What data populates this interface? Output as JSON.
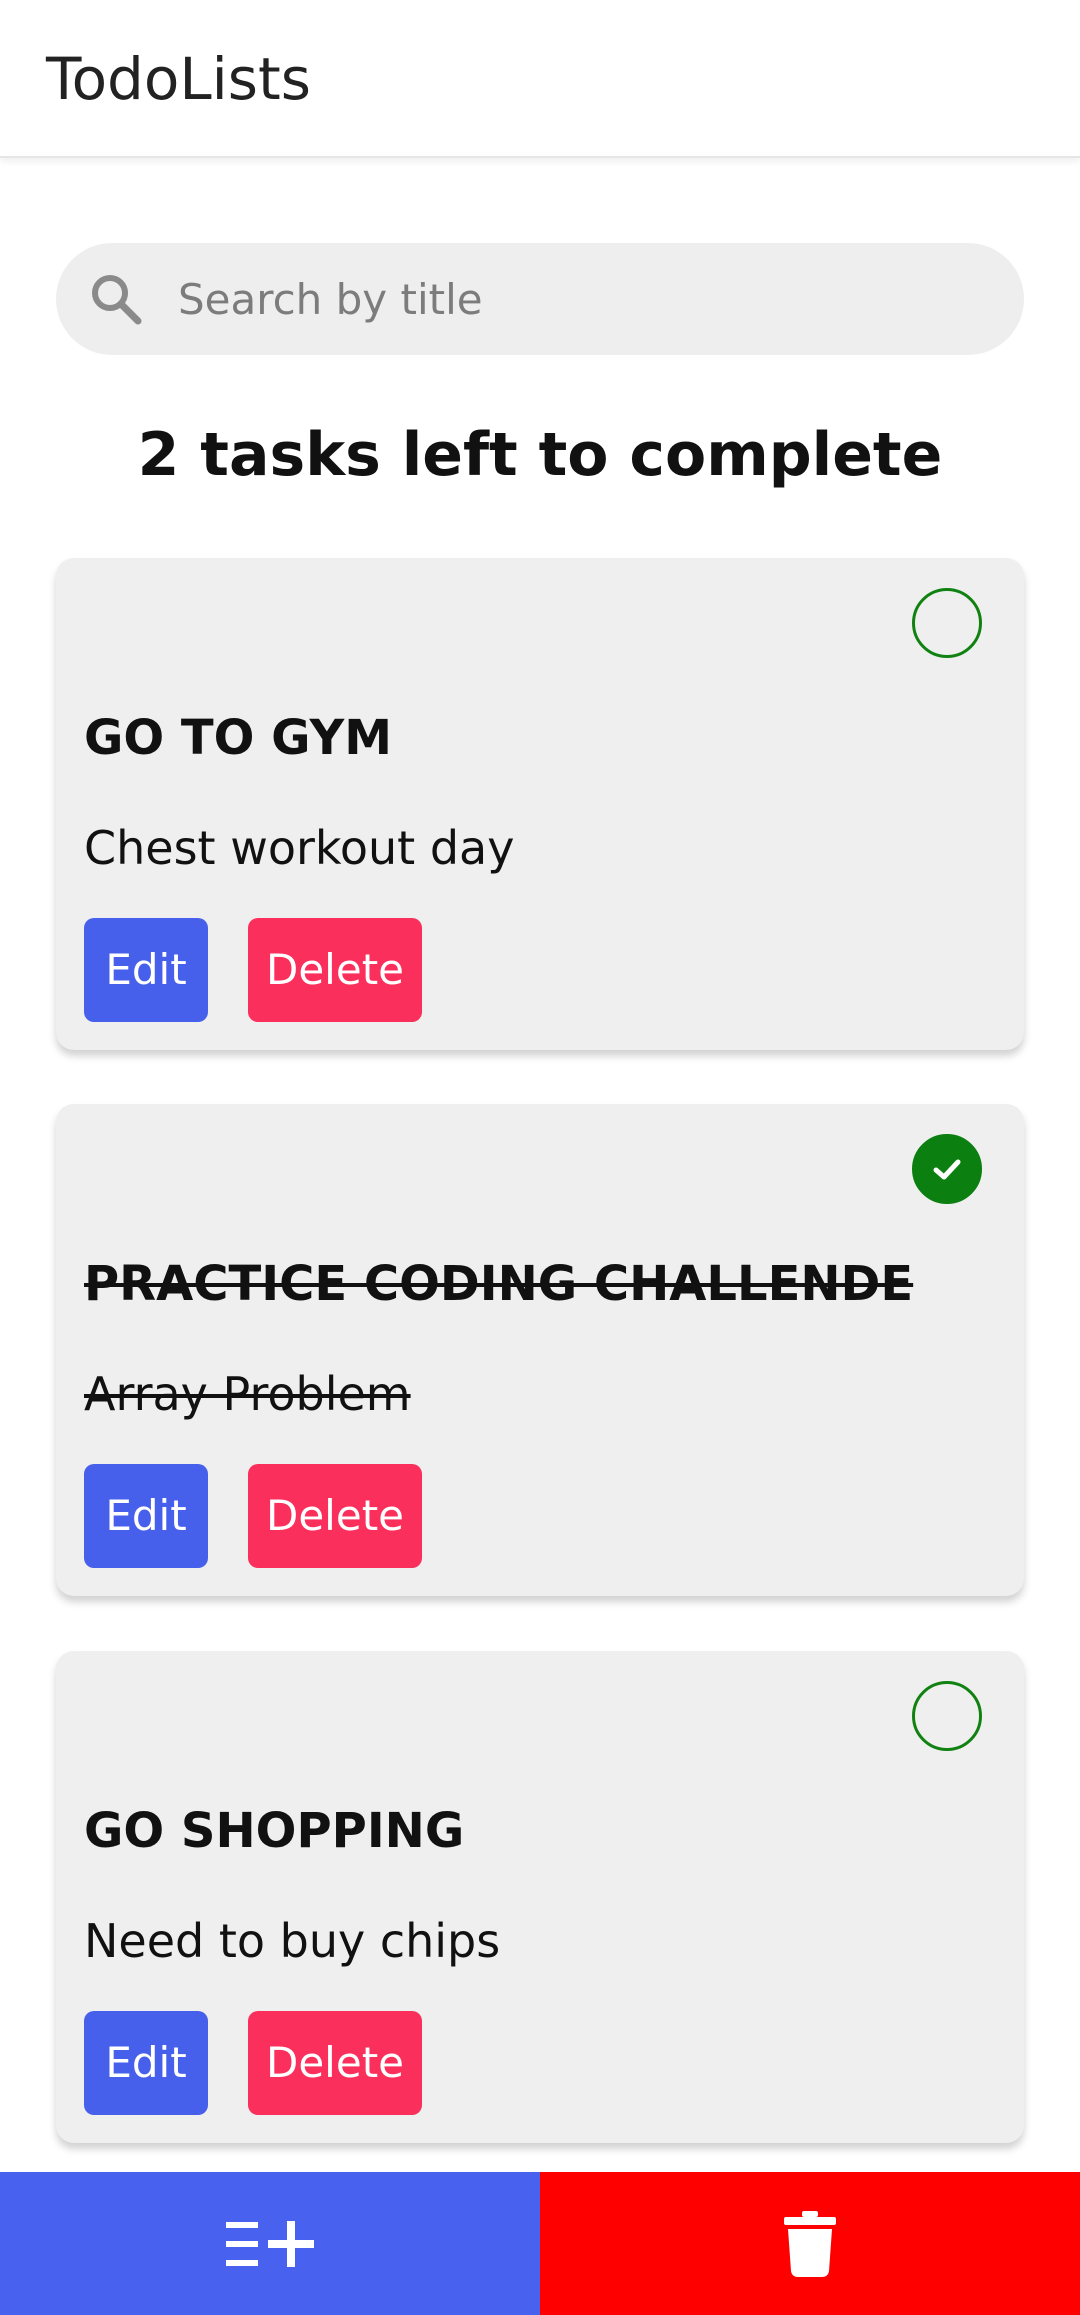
{
  "app": {
    "title": "TodoLists"
  },
  "search": {
    "placeholder": "Search by title",
    "value": ""
  },
  "summary": {
    "text": "2 tasks left to complete"
  },
  "tasks": [
    {
      "title": "GO TO GYM",
      "description": "Chest workout day",
      "completed": false,
      "edit_label": "Edit",
      "delete_label": "Delete"
    },
    {
      "title": "PRACTICE CODING CHALLENDE",
      "description": "Array Problem",
      "completed": true,
      "edit_label": "Edit",
      "delete_label": "Delete"
    },
    {
      "title": "GO SHOPPING",
      "description": "Need to buy chips",
      "completed": false,
      "edit_label": "Edit",
      "delete_label": "Delete"
    }
  ],
  "bottom_bar": {
    "add_icon": "playlist-add-icon",
    "clear_icon": "trash-icon"
  },
  "colors": {
    "primary": "#4861ee",
    "danger": "#ff0000",
    "delete_button": "#fa2f5c",
    "complete_green": "#0b7f10",
    "card_background": "#efefef"
  }
}
